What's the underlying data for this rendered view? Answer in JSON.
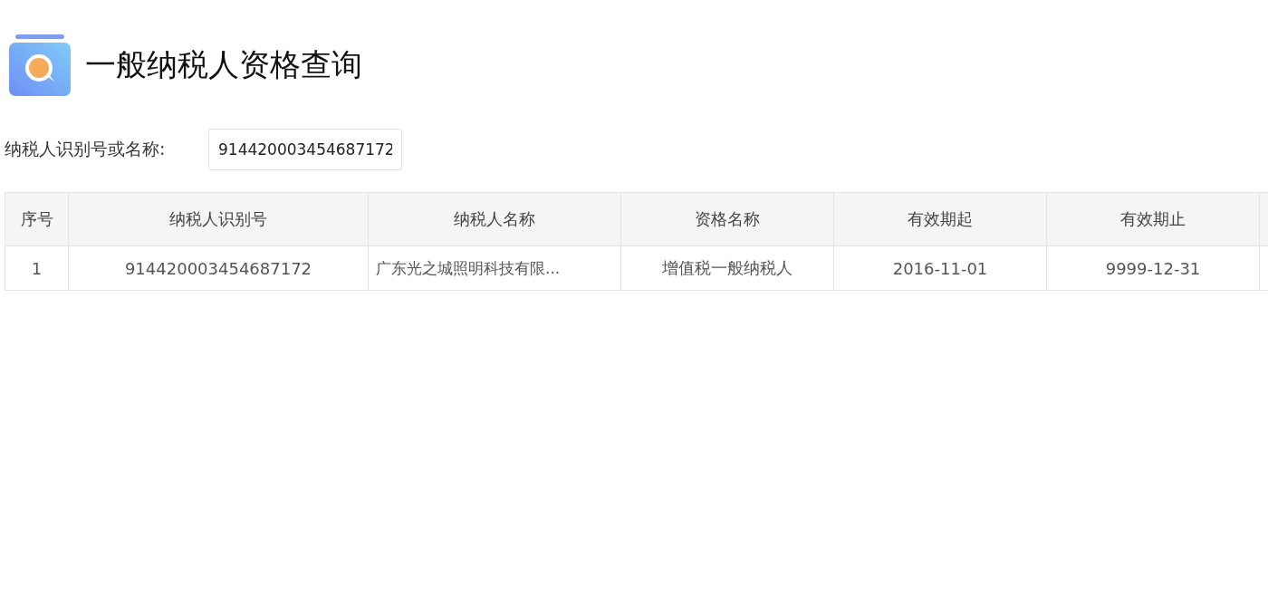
{
  "title": "一般纳税人资格查询",
  "search": {
    "label": "纳税人识别号或名称:",
    "value": "914420003454687172"
  },
  "table": {
    "columns": [
      "序号",
      "纳税人识别号",
      "纳税人名称",
      "资格名称",
      "有效期起",
      "有效期止"
    ],
    "rows": [
      [
        "1",
        "914420003454687172",
        "广东光之城照明科技有限...",
        "增值税一般纳税人",
        "2016-11-01",
        "9999-12-31"
      ]
    ]
  }
}
